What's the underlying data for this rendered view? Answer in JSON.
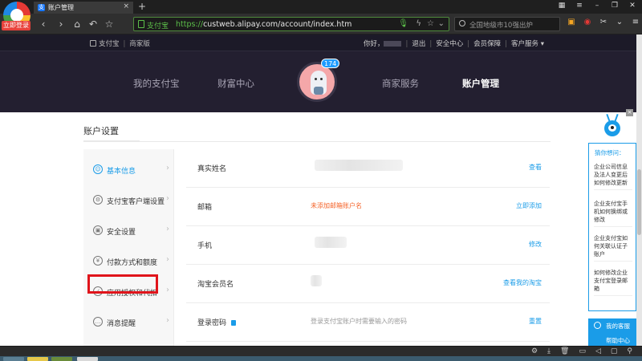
{
  "browser": {
    "login_badge": "立即登录",
    "tab_title": "账户管理",
    "tab_close": "×",
    "new_tab": "+",
    "url_site_label": "支付宝",
    "url_scheme": "https://",
    "url_rest": "custweb.alipay.com/account/index.htm",
    "search_placeholder": "全国地级市10强出炉"
  },
  "ali_top": {
    "brand": "支付宝",
    "brand_sub": "商家版",
    "greeting": "你好，",
    "logout": "退出",
    "security_center": "安全中心",
    "member_guarantee": "会员保障",
    "customer_service": "客户服务 ▾"
  },
  "ali_nav": {
    "items": [
      "我的支付宝",
      "财富中心",
      "商家服务",
      "账户管理"
    ],
    "active": "账户管理",
    "badge_count": "174"
  },
  "account": {
    "section_title": "账户设置",
    "sidebar": [
      {
        "label": "基本信息",
        "icon": "user-icon"
      },
      {
        "label": "支付宝客户端设置",
        "icon": "phone-settings-icon"
      },
      {
        "label": "安全设置",
        "icon": "lock-icon"
      },
      {
        "label": "付款方式和额度",
        "icon": "yuan-icon"
      },
      {
        "label": "应用授权和代扣",
        "icon": "authorize-icon"
      },
      {
        "label": "消息提醒",
        "icon": "chat-icon"
      }
    ],
    "rows": [
      {
        "label": "真实姓名",
        "value": "",
        "action": "查看"
      },
      {
        "label": "邮箱",
        "value": "未添加邮箱账户名",
        "action": "立即添加"
      },
      {
        "label": "手机",
        "value": "",
        "action": "修改"
      },
      {
        "label": "淘宝会员名",
        "value": "",
        "action": "查看我的淘宝"
      },
      {
        "label": "登录密码",
        "value": "登录支付宝账户时需要输入的密码",
        "action": "重置"
      }
    ]
  },
  "helper": {
    "title": "猜你想问：",
    "questions": [
      "企业公司信息及法人变更后如何修改更新",
      "企业支付宝手机如何换绑或修改",
      "企业支付宝如何关联认证子账户",
      "如何修改企业支付宝登录邮箱"
    ],
    "my_service": "我的客服",
    "help_center": "帮助中心",
    "close": "×"
  },
  "colors": {
    "accent": "#1a9ce8",
    "warning": "#f5642a",
    "highlight": "#e0141b",
    "nav_bg": "#231f30"
  }
}
